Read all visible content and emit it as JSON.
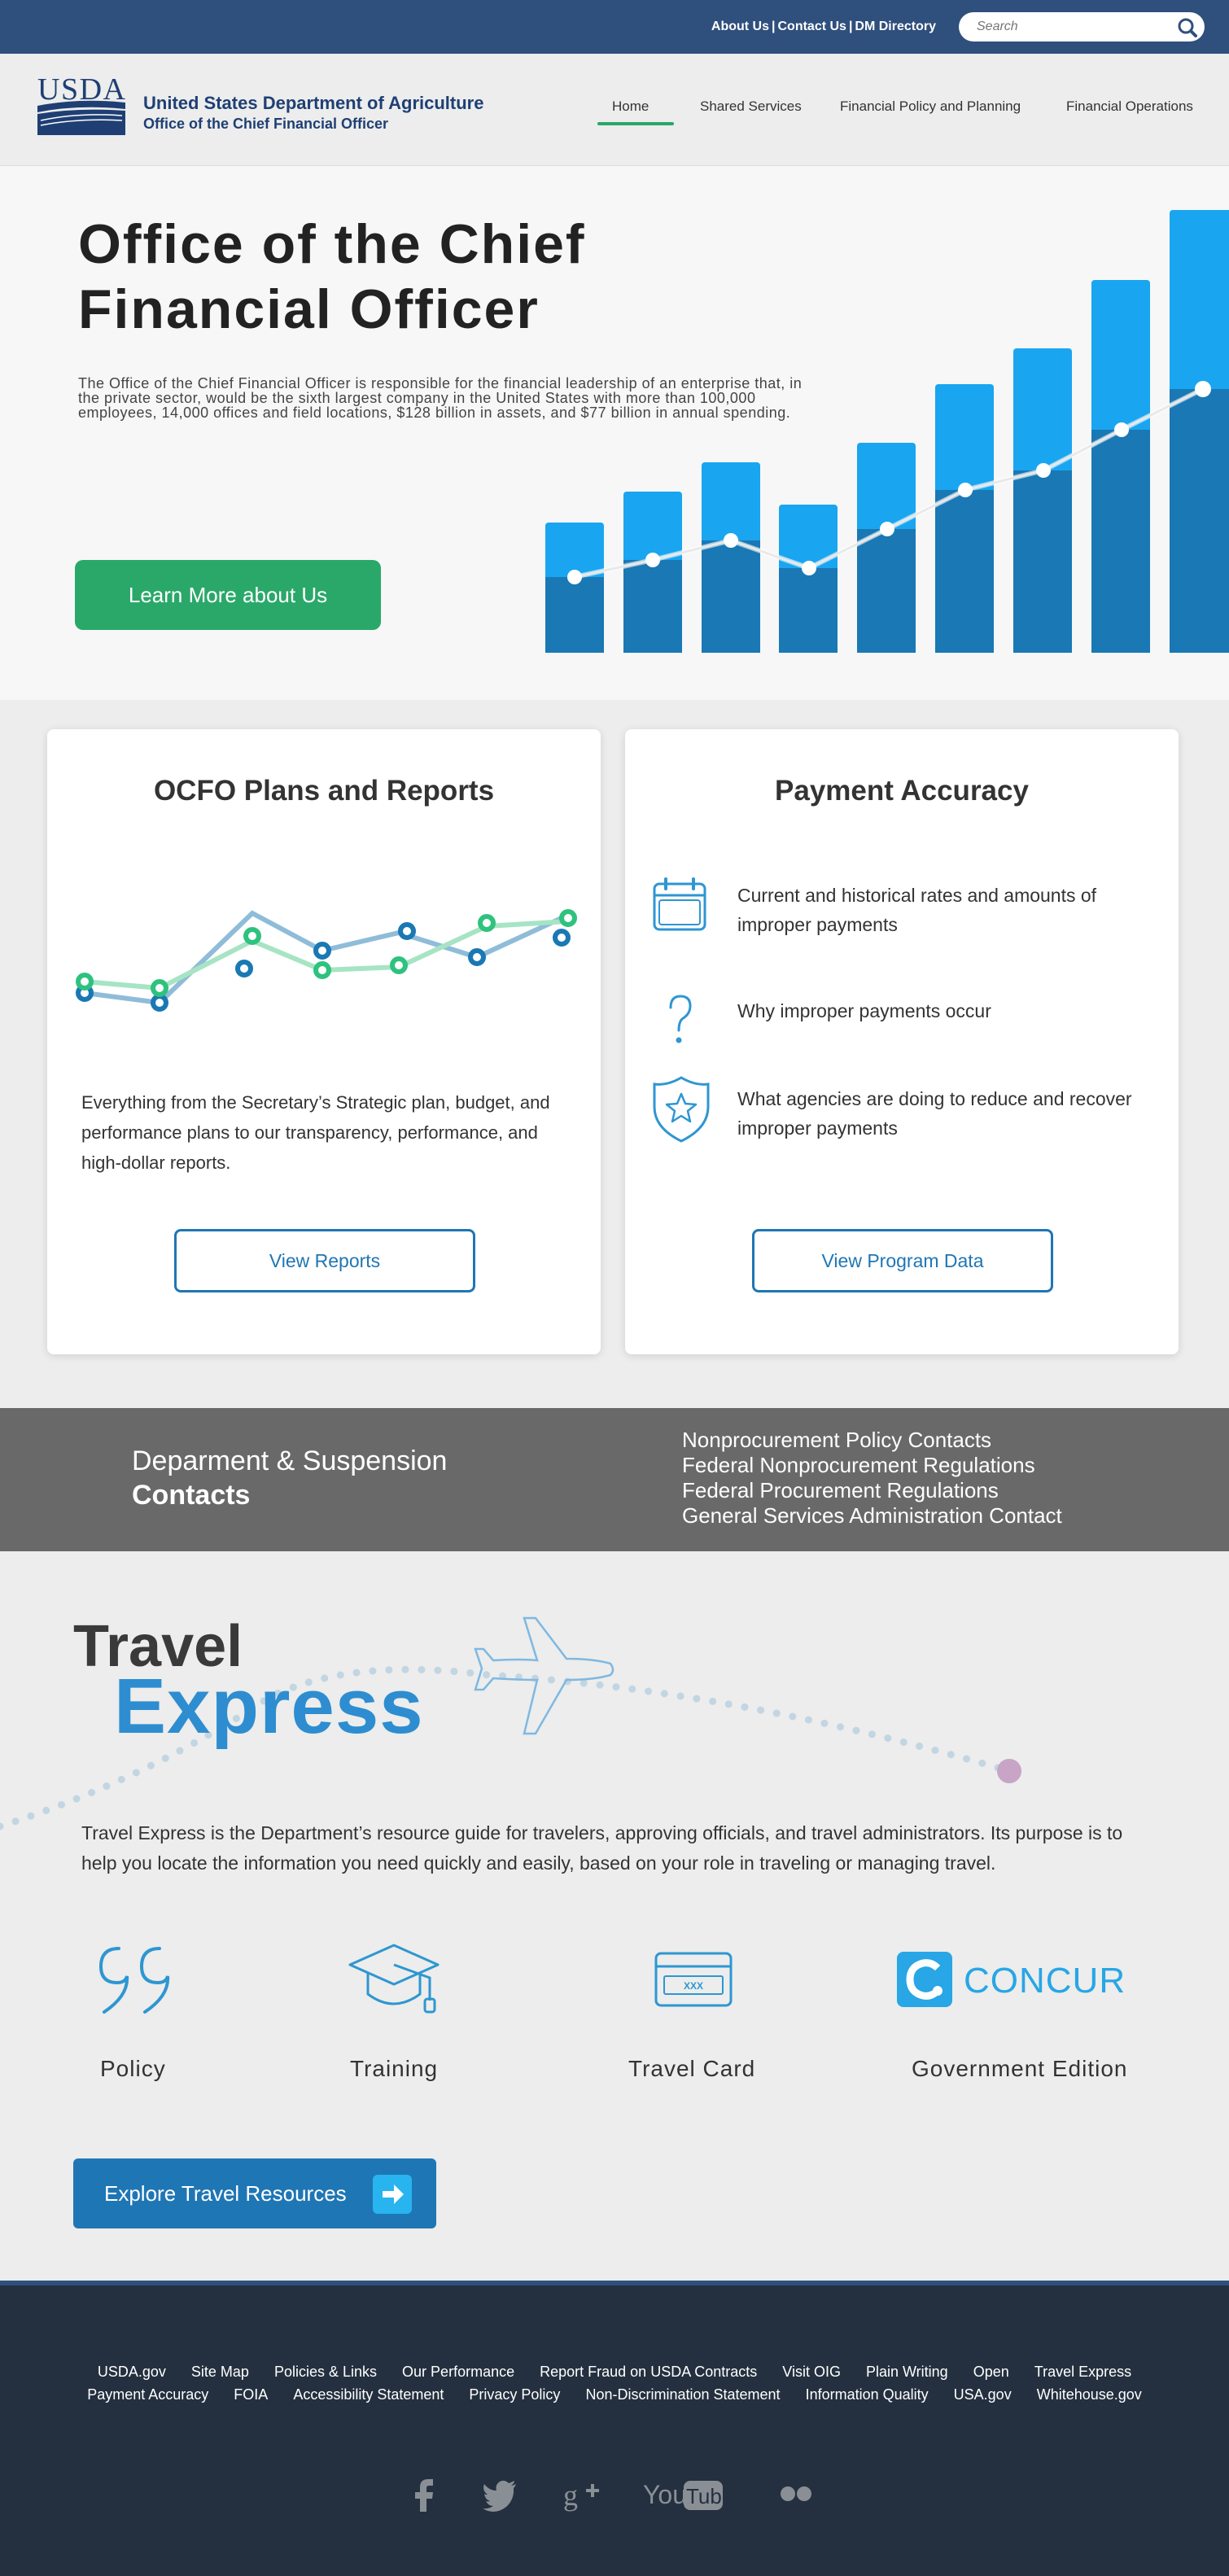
{
  "topbar": {
    "links": [
      "About Us",
      "Contact Us",
      "DM Directory"
    ],
    "separator": "|",
    "search_placeholder": "Search"
  },
  "header": {
    "logo_text": "USDA",
    "agency_name": "United States Department of Agriculture",
    "office_name": "Office of the Chief Financial Officer",
    "nav": [
      "Home",
      "Shared Services",
      "Financial Policy and Planning",
      "Financial Operations"
    ],
    "active_nav": "Home"
  },
  "hero": {
    "title": "Office of the Chief Financial Officer",
    "description": "The Office of the Chief Financial Officer is responsible for the financial leadership of an enterprise that, in the private sector, would be the sixth largest company in the United States with more than 100,000 employees, 14,000 offices and field locations, $128 billion in assets, and $77 billion in annual spending.",
    "cta": "Learn More about Us"
  },
  "plans": {
    "title": "OCFO Plans and Reports",
    "description": "Everything from the Secretary’s Strategic plan, budget, and performance plans to our transparency, performance, and high-dollar reports.",
    "button": "View Reports"
  },
  "payment": {
    "title": "Payment Accuracy",
    "items": [
      {
        "icon": "calendar-icon",
        "text": "Current and historical rates and amounts of improper payments"
      },
      {
        "icon": "question-icon",
        "text": "Why improper payments occur"
      },
      {
        "icon": "shield-star-icon",
        "text": "What agencies are doing to reduce and recover improper payments"
      }
    ],
    "button": "View Program Data"
  },
  "debarment": {
    "title_line1": "Deparment & Suspension",
    "title_line2": "Contacts",
    "links": [
      "Nonprocurement Policy Contacts",
      "Federal Nonprocurement Regulations",
      "Federal Procurement Regulations",
      "General Services Administration Contact"
    ]
  },
  "travel": {
    "logo_line1": "Travel",
    "logo_line2": "Express",
    "intro": "Travel Express is the Department’s resource guide for travelers, approving officials, and travel administrators. Its purpose is to help you locate the information you need quickly and easily, based on your role in traveling or managing travel.",
    "resources": [
      {
        "icon": "quote-icon",
        "label": "Policy"
      },
      {
        "icon": "graduation-cap-icon",
        "label": "Training"
      },
      {
        "icon": "credit-card-icon",
        "label": "Travel Card",
        "card_text": "XXX"
      },
      {
        "icon": "concur-logo",
        "label": "Government Edition",
        "brand_text": "CONCUR"
      }
    ],
    "button": "Explore Travel Resources"
  },
  "footer": {
    "row1": [
      "USDA.gov",
      "Site Map",
      "Policies & Links",
      "Our Performance",
      "Report Fraud on USDA Contracts",
      "Visit OIG",
      "Plain Writing",
      "Open",
      "Travel Express"
    ],
    "row2": [
      "Payment Accuracy",
      "FOIA",
      "Accessibility Statement",
      "Privacy Policy",
      "Non-Discrimination Statement",
      "Information Quality",
      "USA.gov",
      "Whitehouse.gov"
    ],
    "social": [
      "facebook-icon",
      "twitter-icon",
      "google-plus-icon",
      "youtube-icon",
      "flickr-icon"
    ],
    "youtube_text": [
      "You",
      "Tube"
    ]
  },
  "colors": {
    "navy": "#2f4f7d",
    "green": "#2aa86a",
    "blue": "#1f76b5",
    "light_blue": "#1aa5f0",
    "dark_blue": "#1a78b4"
  }
}
